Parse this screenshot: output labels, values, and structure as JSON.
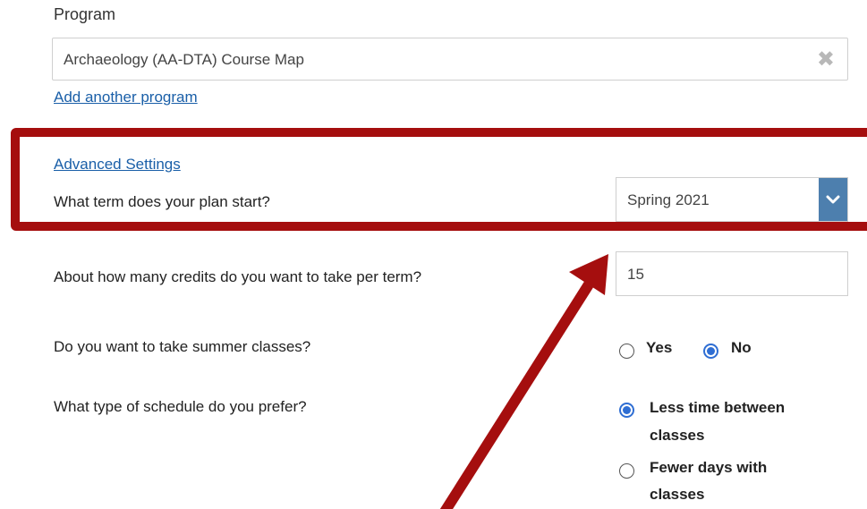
{
  "program": {
    "label": "Program",
    "value": "Archaeology (AA-DTA) Course Map",
    "clear_icon": "✖",
    "add_link": "Add another program"
  },
  "advanced_settings_link": "Advanced Settings",
  "term": {
    "question": "What term does your plan start?",
    "selected": "Spring 2021"
  },
  "credits": {
    "question": "About how many credits do you want to take per term?",
    "value": "15"
  },
  "summer": {
    "question": "Do you want to take summer classes?",
    "options": [
      "Yes",
      "No"
    ],
    "selected": "No"
  },
  "schedule": {
    "question": "What type of schedule do you prefer?",
    "options": [
      "Less time between classes",
      "Fewer days with classes"
    ],
    "option_lines": [
      [
        "Less time between",
        "classes"
      ],
      [
        "Fewer days with",
        "classes"
      ]
    ],
    "selected": "Less time between classes"
  },
  "colors": {
    "highlight": "#a50e0e",
    "link": "#1a5fa8",
    "radio_checked": "#2f6ed3",
    "dropdown_button": "#4d7fae"
  },
  "icons": {
    "clear": "clear-x-icon",
    "dropdown": "chevron-down-icon",
    "annotation": "arrow-annotation"
  }
}
